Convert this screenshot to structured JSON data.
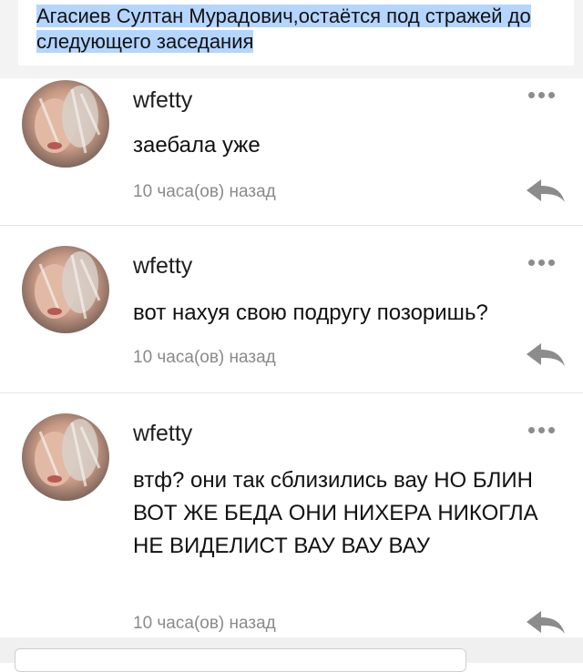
{
  "quote": {
    "text": "Агасиев Султан Мурадович,остаётся под стражей до следующего заседания"
  },
  "comments": [
    {
      "username": "wfetty",
      "text": "заебала уже",
      "time": "10 часа(ов) назад",
      "more_icon": "more-dots-icon",
      "reply_icon": "reply-arrow-icon"
    },
    {
      "username": "wfetty",
      "text": "вот нахуя свою подругу позоришь?",
      "time": "10 часа(ов) назад",
      "more_icon": "more-dots-icon",
      "reply_icon": "reply-arrow-icon"
    },
    {
      "username": "wfetty",
      "text": "втф? они так сблизились вау НО БЛИН ВОТ ЖЕ БЕДА ОНИ НИХЕРА НИКОГЛА НЕ ВИДЕЛИСТ ВАУ ВАУ ВАУ",
      "time": "10 часа(ов) назад",
      "more_icon": "more-dots-icon",
      "reply_icon": "reply-arrow-icon"
    }
  ],
  "colors": {
    "highlight": "#b4d5fe",
    "muted_text": "#8a8a8a",
    "icon_gray": "#8c8c8c",
    "divider": "#e4e4e4"
  }
}
